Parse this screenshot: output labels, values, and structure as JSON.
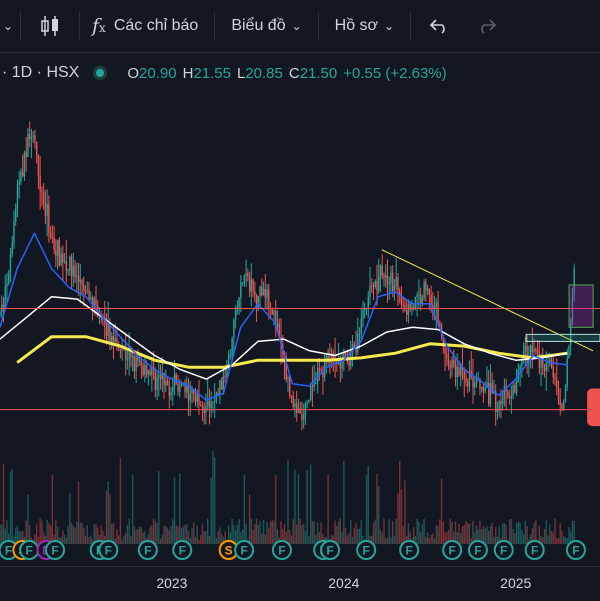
{
  "toolbar": {
    "indicators_label": "Các chỉ báo",
    "chart_label": "Biểu đồ",
    "profile_label": "Hồ sơ"
  },
  "symbol": {
    "interval_exchange": "· 1D · HSX",
    "open_label": "O",
    "open": "20.90",
    "high_label": "H",
    "high": "21.55",
    "low_label": "L",
    "low": "20.85",
    "close_label": "C",
    "close": "21.50",
    "change": "+0.55 (+2.63%)",
    "up_color": "#26a69a",
    "down_color": "#ef5350"
  },
  "chart_data": {
    "type": "candlestick",
    "x_ticks": [
      "2023",
      "2024",
      "2025"
    ],
    "price_path": [
      {
        "t": 2022.0,
        "p": 19.5
      },
      {
        "t": 2022.05,
        "p": 21.0
      },
      {
        "t": 2022.1,
        "p": 24.8
      },
      {
        "t": 2022.18,
        "p": 27.5
      },
      {
        "t": 2022.22,
        "p": 26.0
      },
      {
        "t": 2022.26,
        "p": 24.0
      },
      {
        "t": 2022.32,
        "p": 22.4
      },
      {
        "t": 2022.4,
        "p": 21.7
      },
      {
        "t": 2022.48,
        "p": 20.6
      },
      {
        "t": 2022.55,
        "p": 20.0
      },
      {
        "t": 2022.62,
        "p": 18.8
      },
      {
        "t": 2022.7,
        "p": 18.2
      },
      {
        "t": 2022.78,
        "p": 17.4
      },
      {
        "t": 2022.86,
        "p": 17.2
      },
      {
        "t": 2022.95,
        "p": 16.6
      },
      {
        "t": 2023.02,
        "p": 16.5
      },
      {
        "t": 2023.12,
        "p": 16.2
      },
      {
        "t": 2023.22,
        "p": 15.5
      },
      {
        "t": 2023.3,
        "p": 16.7
      },
      {
        "t": 2023.36,
        "p": 19.2
      },
      {
        "t": 2023.42,
        "p": 21.2
      },
      {
        "t": 2023.48,
        "p": 20.3
      },
      {
        "t": 2023.55,
        "p": 20.7
      },
      {
        "t": 2023.62,
        "p": 18.6
      },
      {
        "t": 2023.7,
        "p": 15.8
      },
      {
        "t": 2023.76,
        "p": 15.0
      },
      {
        "t": 2023.82,
        "p": 16.5
      },
      {
        "t": 2023.9,
        "p": 17.6
      },
      {
        "t": 2023.98,
        "p": 17.4
      },
      {
        "t": 2024.06,
        "p": 18.0
      },
      {
        "t": 2024.14,
        "p": 20.4
      },
      {
        "t": 2024.22,
        "p": 21.4
      },
      {
        "t": 2024.3,
        "p": 20.6
      },
      {
        "t": 2024.36,
        "p": 19.8
      },
      {
        "t": 2024.42,
        "p": 20.0
      },
      {
        "t": 2024.48,
        "p": 20.8
      },
      {
        "t": 2024.54,
        "p": 19.6
      },
      {
        "t": 2024.6,
        "p": 17.6
      },
      {
        "t": 2024.68,
        "p": 17.0
      },
      {
        "t": 2024.74,
        "p": 16.8
      },
      {
        "t": 2024.82,
        "p": 16.2
      },
      {
        "t": 2024.9,
        "p": 15.8
      },
      {
        "t": 2024.98,
        "p": 16.4
      },
      {
        "t": 2025.04,
        "p": 17.8
      },
      {
        "t": 2025.1,
        "p": 18.0
      },
      {
        "t": 2025.14,
        "p": 17.5
      },
      {
        "t": 2025.2,
        "p": 17.8
      },
      {
        "t": 2025.26,
        "p": 15.2
      },
      {
        "t": 2025.3,
        "p": 17.2
      },
      {
        "t": 2025.34,
        "p": 21.5
      }
    ],
    "ma_long": [
      {
        "t": 2022.1,
        "p": 17.5
      },
      {
        "t": 2022.3,
        "p": 18.6
      },
      {
        "t": 2022.5,
        "p": 18.6
      },
      {
        "t": 2022.7,
        "p": 18.2
      },
      {
        "t": 2022.9,
        "p": 17.6
      },
      {
        "t": 2023.1,
        "p": 17.3
      },
      {
        "t": 2023.3,
        "p": 17.3
      },
      {
        "t": 2023.5,
        "p": 17.6
      },
      {
        "t": 2023.7,
        "p": 17.6
      },
      {
        "t": 2023.9,
        "p": 17.6
      },
      {
        "t": 2024.1,
        "p": 17.7
      },
      {
        "t": 2024.3,
        "p": 17.9
      },
      {
        "t": 2024.5,
        "p": 18.3
      },
      {
        "t": 2024.7,
        "p": 18.2
      },
      {
        "t": 2024.9,
        "p": 17.9
      },
      {
        "t": 2025.1,
        "p": 17.7
      },
      {
        "t": 2025.3,
        "p": 17.9
      }
    ],
    "ma_mid": [
      {
        "t": 2022.0,
        "p": 18.5
      },
      {
        "t": 2022.15,
        "p": 19.4
      },
      {
        "t": 2022.3,
        "p": 20.3
      },
      {
        "t": 2022.45,
        "p": 20.2
      },
      {
        "t": 2022.6,
        "p": 19.4
      },
      {
        "t": 2022.75,
        "p": 18.6
      },
      {
        "t": 2022.9,
        "p": 17.8
      },
      {
        "t": 2023.05,
        "p": 17.2
      },
      {
        "t": 2023.2,
        "p": 16.8
      },
      {
        "t": 2023.35,
        "p": 17.4
      },
      {
        "t": 2023.5,
        "p": 18.4
      },
      {
        "t": 2023.65,
        "p": 18.5
      },
      {
        "t": 2023.8,
        "p": 18.0
      },
      {
        "t": 2023.95,
        "p": 17.8
      },
      {
        "t": 2024.1,
        "p": 18.2
      },
      {
        "t": 2024.25,
        "p": 18.8
      },
      {
        "t": 2024.4,
        "p": 19.0
      },
      {
        "t": 2024.55,
        "p": 18.9
      },
      {
        "t": 2024.7,
        "p": 18.3
      },
      {
        "t": 2024.85,
        "p": 17.9
      },
      {
        "t": 2025.0,
        "p": 17.6
      },
      {
        "t": 2025.15,
        "p": 17.7
      },
      {
        "t": 2025.3,
        "p": 17.9
      }
    ],
    "ma_short": [
      {
        "t": 2022.0,
        "p": 19.0
      },
      {
        "t": 2022.1,
        "p": 21.5
      },
      {
        "t": 2022.2,
        "p": 23.0
      },
      {
        "t": 2022.3,
        "p": 21.5
      },
      {
        "t": 2022.4,
        "p": 20.7
      },
      {
        "t": 2022.5,
        "p": 20.3
      },
      {
        "t": 2022.6,
        "p": 19.4
      },
      {
        "t": 2022.7,
        "p": 18.6
      },
      {
        "t": 2022.8,
        "p": 17.8
      },
      {
        "t": 2022.9,
        "p": 17.2
      },
      {
        "t": 2023.0,
        "p": 16.8
      },
      {
        "t": 2023.1,
        "p": 16.5
      },
      {
        "t": 2023.2,
        "p": 15.9
      },
      {
        "t": 2023.3,
        "p": 16.2
      },
      {
        "t": 2023.4,
        "p": 19.0
      },
      {
        "t": 2023.5,
        "p": 20.0
      },
      {
        "t": 2023.6,
        "p": 19.2
      },
      {
        "t": 2023.7,
        "p": 16.6
      },
      {
        "t": 2023.8,
        "p": 16.5
      },
      {
        "t": 2023.9,
        "p": 17.3
      },
      {
        "t": 2024.0,
        "p": 17.6
      },
      {
        "t": 2024.1,
        "p": 18.4
      },
      {
        "t": 2024.2,
        "p": 20.3
      },
      {
        "t": 2024.3,
        "p": 20.5
      },
      {
        "t": 2024.4,
        "p": 20.0
      },
      {
        "t": 2024.5,
        "p": 20.0
      },
      {
        "t": 2024.6,
        "p": 18.2
      },
      {
        "t": 2024.7,
        "p": 17.2
      },
      {
        "t": 2024.8,
        "p": 16.7
      },
      {
        "t": 2024.9,
        "p": 16.1
      },
      {
        "t": 2025.0,
        "p": 16.8
      },
      {
        "t": 2025.1,
        "p": 17.8
      },
      {
        "t": 2025.2,
        "p": 17.5
      },
      {
        "t": 2025.3,
        "p": 17.4
      }
    ],
    "h_lines": [
      19.8,
      15.5
    ],
    "trendline": [
      {
        "t": 2024.22,
        "p": 22.3
      },
      {
        "t": 2025.45,
        "p": 18.0
      }
    ],
    "markers": [
      {
        "t": 2022.05,
        "label": "F",
        "color": "#26a69a"
      },
      {
        "t": 2022.13,
        "label": "S",
        "color": "#ff9800"
      },
      {
        "t": 2022.17,
        "label": "F",
        "color": "#26a69a"
      },
      {
        "t": 2022.27,
        "label": "D",
        "color": "#9c27b0"
      },
      {
        "t": 2022.32,
        "label": "F",
        "color": "#26a69a"
      },
      {
        "t": 2022.58,
        "label": "F",
        "color": "#26a69a"
      },
      {
        "t": 2022.63,
        "label": "F",
        "color": "#26a69a"
      },
      {
        "t": 2022.86,
        "label": "F",
        "color": "#26a69a"
      },
      {
        "t": 2023.06,
        "label": "F",
        "color": "#26a69a"
      },
      {
        "t": 2023.33,
        "label": "S",
        "color": "#ff9800"
      },
      {
        "t": 2023.42,
        "label": "F",
        "color": "#26a69a"
      },
      {
        "t": 2023.64,
        "label": "F",
        "color": "#26a69a"
      },
      {
        "t": 2023.88,
        "label": "F",
        "color": "#26a69a"
      },
      {
        "t": 2023.92,
        "label": "F",
        "color": "#26a69a"
      },
      {
        "t": 2024.13,
        "label": "F",
        "color": "#26a69a"
      },
      {
        "t": 2024.38,
        "label": "F",
        "color": "#26a69a"
      },
      {
        "t": 2024.63,
        "label": "F",
        "color": "#26a69a"
      },
      {
        "t": 2024.78,
        "label": "F",
        "color": "#26a69a"
      },
      {
        "t": 2024.93,
        "label": "F",
        "color": "#26a69a"
      },
      {
        "t": 2025.11,
        "label": "F",
        "color": "#26a69a"
      },
      {
        "t": 2025.35,
        "label": "F",
        "color": "#26a69a"
      }
    ]
  }
}
